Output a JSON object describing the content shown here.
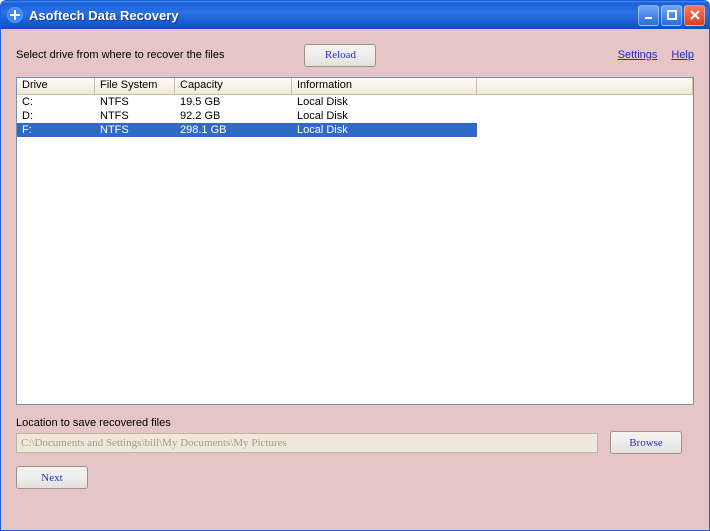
{
  "window": {
    "title": "Asoftech Data Recovery"
  },
  "top": {
    "instruction": "Select drive from where to recover the files",
    "reload_label": "Reload",
    "settings_label": "Settings",
    "help_label": "Help"
  },
  "list": {
    "headers": {
      "drive": "Drive",
      "fs": "File System",
      "cap": "Capacity",
      "info": "Information"
    },
    "rows": [
      {
        "drive": "C:",
        "fs": "NTFS",
        "cap": "19.5 GB",
        "info": "Local Disk",
        "selected": false
      },
      {
        "drive": "D:",
        "fs": "NTFS",
        "cap": "92.2 GB",
        "info": "Local Disk",
        "selected": false
      },
      {
        "drive": "F:",
        "fs": "NTFS",
        "cap": "298.1 GB",
        "info": "Local Disk",
        "selected": true
      }
    ]
  },
  "location": {
    "label": "Location to save recovered files",
    "value": "C:\\Documents and Settings\\bill\\My Documents\\My Pictures",
    "browse_label": "Browse"
  },
  "footer": {
    "next_label": "Next"
  }
}
